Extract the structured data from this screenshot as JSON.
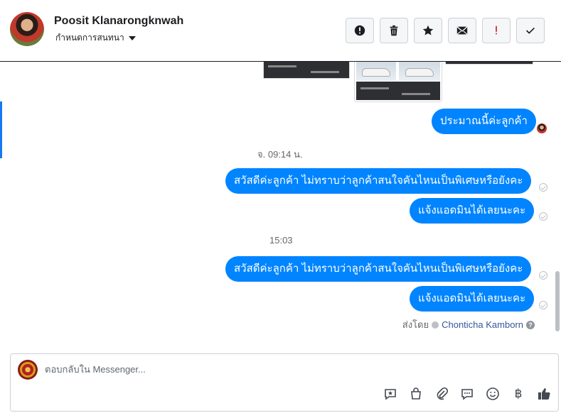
{
  "header": {
    "contact_name": "Poosit Klanarongknwah",
    "conversation_label": "กำหนดการสนทนา",
    "actions": [
      {
        "name": "report-icon",
        "label": "report"
      },
      {
        "name": "trash-icon",
        "label": "delete"
      },
      {
        "name": "star-icon",
        "label": "star"
      },
      {
        "name": "mail-icon",
        "label": "mark unread"
      },
      {
        "name": "exclamation-icon",
        "label": "flag"
      },
      {
        "name": "check-icon",
        "label": "done"
      }
    ]
  },
  "messages": [
    {
      "text": "ประมาณนี้ค่ะลูกค้า"
    },
    {
      "time": "จ. 09:14 น."
    },
    {
      "text": "สวัสดีค่ะลูกค้า ไม่ทราบว่าลูกค้าสนใจคันไหนเป็นพิเศษหรือยังคะ"
    },
    {
      "text": "แจ้งแอดมินได้เลยนะคะ"
    },
    {
      "time": "15:03"
    },
    {
      "text": "สวัสดีค่ะลูกค้า ไม่ทราบว่าลูกค้าสนใจคันไหนเป็นพิเศษหรือยังคะ"
    },
    {
      "text": "แจ้งแอดมินได้เลยนะคะ"
    }
  ],
  "sent_by": {
    "prefix": "ส่งโดย",
    "name": "Chonticha Kamborn",
    "help": "?"
  },
  "composer": {
    "placeholder": "ตอบกลับใน Messenger...",
    "tools": [
      "saved-reply-icon",
      "shop-icon",
      "attachment-icon",
      "chat-bubble-icon",
      "emoji-icon",
      "baht-icon",
      "thumbs-up-icon"
    ],
    "baht_glyph": "฿"
  },
  "colors": {
    "bubble": "#0084ff",
    "accent": "#1877f2"
  }
}
